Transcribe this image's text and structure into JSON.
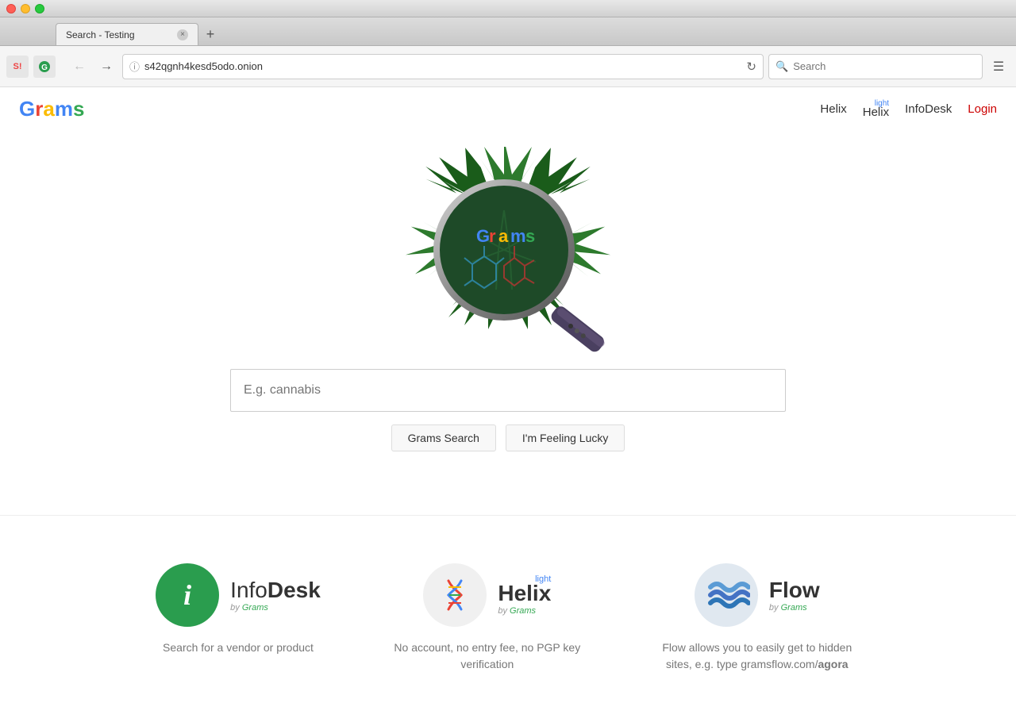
{
  "window": {
    "title": "Search - Testing",
    "url": "s42qgnh4kesd5odo.onion"
  },
  "browser": {
    "back_disabled": false,
    "forward_disabled": true,
    "search_placeholder": "Search",
    "search_value": ""
  },
  "site": {
    "logo": "Grams",
    "logo_letters": [
      "G",
      "r",
      "a",
      "m",
      "s"
    ],
    "logo_colors": [
      "#4285f4",
      "#ea4335",
      "#fbbc05",
      "#4285f4",
      "#34a853"
    ],
    "nav": {
      "helix_label": "Helix",
      "helix_light_label": "Helix",
      "helix_light_super": "light",
      "infodesk_label": "InfoDesk",
      "login_label": "Login"
    }
  },
  "hero": {
    "search_placeholder": "E.g. cannabis",
    "search_value": "",
    "grams_search_label": "Grams Search",
    "feeling_lucky_label": "I'm Feeling Lucky"
  },
  "services": [
    {
      "id": "infodesk",
      "icon_type": "infodesk",
      "name_part1": "Info",
      "name_part2": "Desk",
      "by_label": "by Grams",
      "description": "Search for a vendor or product"
    },
    {
      "id": "helix",
      "icon_type": "helix",
      "name_part1": "Helix",
      "name_light": "light",
      "by_label": "by Grams",
      "description": "No account, no entry fee, no PGP key verification"
    },
    {
      "id": "flow",
      "icon_type": "flow",
      "name_part1": "Flow",
      "by_label": "by Grams",
      "description": "Flow allows you to easily get to hidden sites, e.g. type gramsflow.com/agora"
    }
  ],
  "flow_description_highlight": "agora"
}
